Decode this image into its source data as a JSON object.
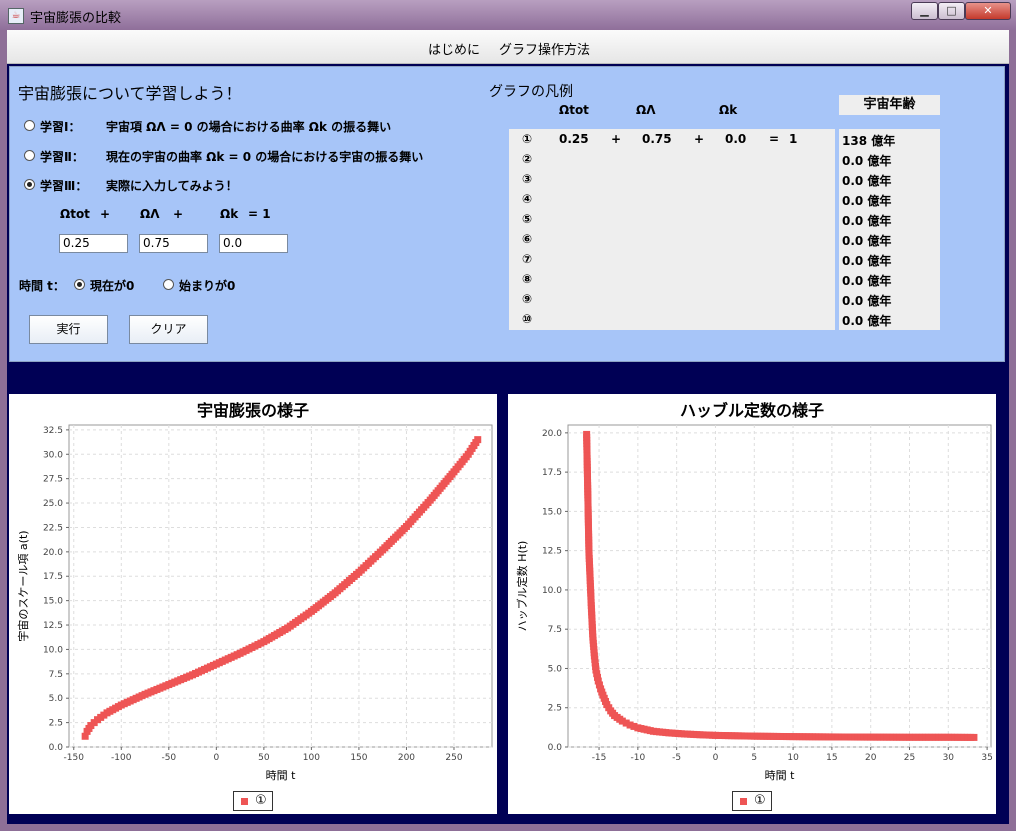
{
  "window": {
    "title": "宇宙膨張の比較",
    "minimize": "▁",
    "maximize": "□",
    "close": "✕"
  },
  "menu": [
    "はじめに",
    "グラフ操作方法"
  ],
  "controls": {
    "heading": "宇宙膨張について学習しよう！",
    "study_items": [
      {
        "label": "学習Ⅰ：",
        "desc": "宇宙項 ΩΛ = 0 の場合における曲率 Ωk の振る舞い",
        "selected": false
      },
      {
        "label": "学習Ⅱ：",
        "desc": "現在の宇宙の曲率 Ωk = 0 の場合における宇宙の振る舞い",
        "selected": false
      },
      {
        "label": "学習Ⅲ：",
        "desc": "実際に入力してみよう！",
        "selected": true
      }
    ],
    "equation": {
      "omega_tot": "Ωtot",
      "plus1": "+",
      "omega_lambda": "ΩΛ",
      "plus2": "+",
      "omega_k": "Ωk",
      "equals": "= 1"
    },
    "inputs": {
      "omega_tot": "0.25",
      "omega_lambda": "0.75",
      "omega_k": "0.0"
    },
    "time_label": "時間 t：",
    "time_options": [
      {
        "label": "現在が0",
        "selected": true
      },
      {
        "label": "始まりが0",
        "selected": false
      }
    ],
    "run_button": "実行",
    "clear_button": "クリア"
  },
  "legend": {
    "title": "グラフの凡例",
    "headers": [
      "Ωtot",
      "ΩΛ",
      "Ωk"
    ],
    "age_header": "宇宙年齢",
    "rows": [
      {
        "mark": "①",
        "tot": "0.25",
        "p1": "+",
        "lam": "0.75",
        "p2": "+",
        "k": "0.0",
        "eq": "=",
        "one": "1",
        "age": "138 億年"
      },
      {
        "mark": "②",
        "tot": "",
        "p1": "",
        "lam": "",
        "p2": "",
        "k": "",
        "eq": "",
        "one": "",
        "age": "0.0 億年"
      },
      {
        "mark": "③",
        "tot": "",
        "p1": "",
        "lam": "",
        "p2": "",
        "k": "",
        "eq": "",
        "one": "",
        "age": "0.0 億年"
      },
      {
        "mark": "④",
        "tot": "",
        "p1": "",
        "lam": "",
        "p2": "",
        "k": "",
        "eq": "",
        "one": "",
        "age": "0.0 億年"
      },
      {
        "mark": "⑤",
        "tot": "",
        "p1": "",
        "lam": "",
        "p2": "",
        "k": "",
        "eq": "",
        "one": "",
        "age": "0.0 億年"
      },
      {
        "mark": "⑥",
        "tot": "",
        "p1": "",
        "lam": "",
        "p2": "",
        "k": "",
        "eq": "",
        "one": "",
        "age": "0.0 億年"
      },
      {
        "mark": "⑦",
        "tot": "",
        "p1": "",
        "lam": "",
        "p2": "",
        "k": "",
        "eq": "",
        "one": "",
        "age": "0.0 億年"
      },
      {
        "mark": "⑧",
        "tot": "",
        "p1": "",
        "lam": "",
        "p2": "",
        "k": "",
        "eq": "",
        "one": "",
        "age": "0.0 億年"
      },
      {
        "mark": "⑨",
        "tot": "",
        "p1": "",
        "lam": "",
        "p2": "",
        "k": "",
        "eq": "",
        "one": "",
        "age": "0.0 億年"
      },
      {
        "mark": "⑩",
        "tot": "",
        "p1": "",
        "lam": "",
        "p2": "",
        "k": "",
        "eq": "",
        "one": "",
        "age": "0.0 億年"
      }
    ]
  },
  "colors": {
    "series": "#ee5555",
    "panel": "#a7c5f8",
    "background": "#000055"
  },
  "chart_data": [
    {
      "type": "scatter",
      "title": "宇宙膨張の様子",
      "xlabel": "時間 t",
      "ylabel": "宇宙のスケール項 a(t)",
      "xlim": [
        -155,
        290
      ],
      "ylim": [
        0,
        33
      ],
      "xticks": [
        -150,
        -100,
        -50,
        0,
        50,
        100,
        150,
        200,
        250
      ],
      "yticks": [
        0.0,
        2.5,
        5.0,
        7.5,
        10.0,
        12.5,
        15.0,
        17.5,
        20.0,
        22.5,
        25.0,
        27.5,
        30.0,
        32.5
      ],
      "grid": true,
      "legend": "bottom",
      "series": [
        {
          "name": "①",
          "points": [
            [
              -138,
              1.1
            ],
            [
              -136,
              1.6
            ],
            [
              -132,
              2.2
            ],
            [
              -125,
              2.8
            ],
            [
              -115,
              3.5
            ],
            [
              -100,
              4.3
            ],
            [
              -75,
              5.4
            ],
            [
              -50,
              6.4
            ],
            [
              -25,
              7.4
            ],
            [
              0,
              8.5
            ],
            [
              25,
              9.6
            ],
            [
              50,
              10.8
            ],
            [
              75,
              12.2
            ],
            [
              100,
              13.9
            ],
            [
              125,
              15.8
            ],
            [
              150,
              17.9
            ],
            [
              175,
              20.2
            ],
            [
              200,
              22.6
            ],
            [
              225,
              25.3
            ],
            [
              250,
              28.2
            ],
            [
              265,
              30.0
            ],
            [
              275,
              31.5
            ]
          ]
        }
      ]
    },
    {
      "type": "scatter",
      "title": "ハッブル定数の様子",
      "xlabel": "時間 t",
      "ylabel": "ハッブル定数 H(t)",
      "xlim": [
        -19,
        35.5
      ],
      "ylim": [
        0,
        20.5
      ],
      "xticks": [
        -15,
        -10,
        -5,
        0,
        5,
        10,
        15,
        20,
        25,
        30,
        35
      ],
      "yticks": [
        0.0,
        2.5,
        5.0,
        7.5,
        10.0,
        12.5,
        15.0,
        17.5,
        20.0
      ],
      "grid": true,
      "legend": "bottom",
      "series": [
        {
          "name": "①",
          "points": [
            [
              -16.6,
              19.9
            ],
            [
              -16.3,
              12.4
            ],
            [
              -16.0,
              9.0
            ],
            [
              -15.8,
              7.0
            ],
            [
              -15.6,
              5.8
            ],
            [
              -15.4,
              4.9
            ],
            [
              -15.1,
              4.2
            ],
            [
              -14.8,
              3.7
            ],
            [
              -14.5,
              3.3
            ],
            [
              -14.0,
              2.7
            ],
            [
              -13.5,
              2.3
            ],
            [
              -13.0,
              2.0
            ],
            [
              -12.0,
              1.65
            ],
            [
              -11.0,
              1.4
            ],
            [
              -10.0,
              1.22
            ],
            [
              -8.0,
              1.0
            ],
            [
              -6.0,
              0.9
            ],
            [
              -4.0,
              0.83
            ],
            [
              -2.0,
              0.78
            ],
            [
              0.0,
              0.74
            ],
            [
              5.0,
              0.69
            ],
            [
              10.0,
              0.66
            ],
            [
              15.0,
              0.64
            ],
            [
              20.0,
              0.63
            ],
            [
              25.0,
              0.62
            ],
            [
              30.0,
              0.62
            ],
            [
              33.3,
              0.61
            ]
          ]
        }
      ]
    }
  ]
}
